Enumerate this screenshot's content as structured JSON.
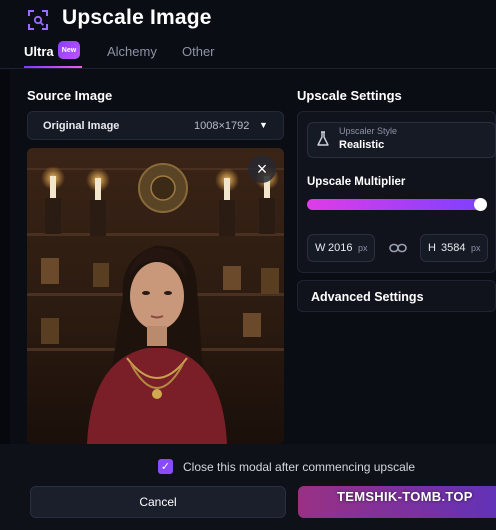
{
  "header": {
    "title": "Upscale Image"
  },
  "tabs": [
    {
      "label": "Ultra",
      "badge": "New",
      "active": true
    },
    {
      "label": "Alchemy",
      "active": false
    },
    {
      "label": "Other",
      "active": false
    }
  ],
  "source": {
    "label": "Source Image",
    "select_label": "Original Image",
    "dimensions": "1008×1792",
    "close_glyph": "×"
  },
  "settings": {
    "label": "Upscale Settings",
    "style_caption": "Upscaler Style",
    "style_value": "Realistic",
    "multiplier_label": "Upscale Multiplier",
    "multiplier_fill": 1.0,
    "width_prefix": "W",
    "width_value": "2016",
    "height_prefix": "H",
    "height_value": "3584",
    "unit": "px",
    "advanced_label": "Advanced Settings"
  },
  "footer": {
    "checkbox_label": "Close this modal after commencing upscale",
    "checkbox_checked": true,
    "check_glyph": "✓",
    "cancel_label": "Cancel",
    "watermark": "TEMSHIK-TOMB.TOP"
  },
  "colors": {
    "accent_purple": "#8a4bff",
    "accent_pink": "#e03ce8",
    "background": "#0b0d14"
  }
}
